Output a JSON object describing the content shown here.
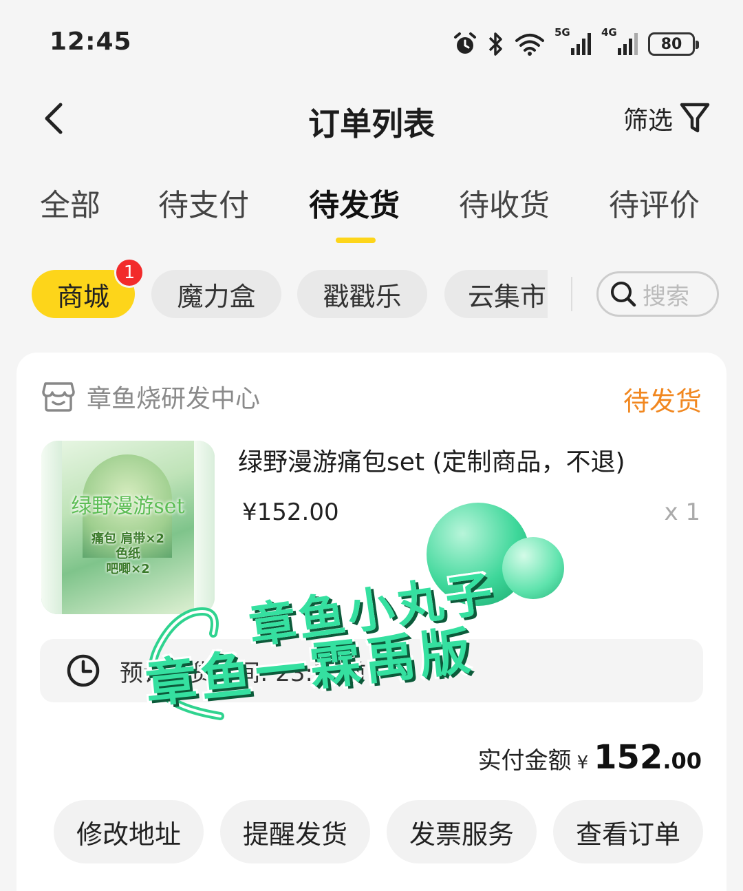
{
  "status_bar": {
    "time": "12:45",
    "net_5g": "5G",
    "net_4g": "4G",
    "battery": "80"
  },
  "header": {
    "title": "订单列表",
    "filter_label": "筛选"
  },
  "tabs": [
    {
      "label": "全部"
    },
    {
      "label": "待支付"
    },
    {
      "label": "待发货",
      "active": true
    },
    {
      "label": "待收货"
    },
    {
      "label": "待评价"
    }
  ],
  "chips": [
    {
      "label": "商城",
      "active": true,
      "badge": "1"
    },
    {
      "label": "魔力盒"
    },
    {
      "label": "戳戳乐"
    },
    {
      "label": "云集市"
    }
  ],
  "search": {
    "placeholder": "搜索"
  },
  "order": {
    "shop_name": "章鱼烧研发中心",
    "status": "待发货",
    "status_color": "#f1871f",
    "product": {
      "name": "绿野漫游痛包set (定制商品，不退)",
      "price": "¥152.00",
      "qty": "x 1",
      "image_title": "绿野漫游set",
      "image_lines": [
        "痛包 肩带×2",
        "色纸",
        "吧唧×2"
      ]
    },
    "shipping_note": "预计发货时间: 23:59前",
    "total": {
      "label": "实付金额",
      "currency": "¥",
      "integer": "152",
      "decimal": ".00"
    },
    "actions": [
      "修改地址",
      "提醒发货",
      "发票服务",
      "查看订单"
    ]
  },
  "watermark": {
    "line1": "章鱼小丸子",
    "line2": "章鱼一霖禹版"
  },
  "colors": {
    "accent_yellow": "#fdd51a",
    "badge_red": "#f22b2b",
    "watermark_green": "#35e0a0"
  }
}
